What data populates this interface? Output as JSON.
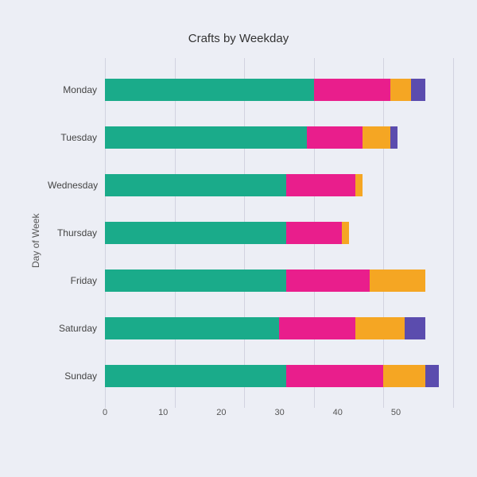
{
  "chart": {
    "title": "Crafts by Weekday",
    "y_axis_label": "Day of Week",
    "x_axis_label": "",
    "x_ticks": [
      0,
      10,
      20,
      30,
      40,
      50
    ],
    "max_value": 50,
    "colors": {
      "teal": "#1aab8a",
      "pink": "#e91e8c",
      "orange": "#f5a623",
      "purple": "#5b4cae"
    },
    "bars": [
      {
        "label": "Monday",
        "segments": [
          {
            "color": "#1aab8a",
            "value": 30
          },
          {
            "color": "#e91e8c",
            "value": 11
          },
          {
            "color": "#f5a623",
            "value": 3
          },
          {
            "color": "#5b4cae",
            "value": 2
          }
        ],
        "total": 46
      },
      {
        "label": "Tuesday",
        "segments": [
          {
            "color": "#1aab8a",
            "value": 29
          },
          {
            "color": "#e91e8c",
            "value": 8
          },
          {
            "color": "#f5a623",
            "value": 4
          },
          {
            "color": "#5b4cae",
            "value": 1
          }
        ],
        "total": 42
      },
      {
        "label": "Wednesday",
        "segments": [
          {
            "color": "#1aab8a",
            "value": 26
          },
          {
            "color": "#e91e8c",
            "value": 10
          },
          {
            "color": "#f5a623",
            "value": 1
          },
          {
            "color": "#5b4cae",
            "value": 0
          }
        ],
        "total": 37
      },
      {
        "label": "Thursday",
        "segments": [
          {
            "color": "#1aab8a",
            "value": 26
          },
          {
            "color": "#e91e8c",
            "value": 8
          },
          {
            "color": "#f5a623",
            "value": 1
          },
          {
            "color": "#5b4cae",
            "value": 0
          }
        ],
        "total": 35
      },
      {
        "label": "Friday",
        "segments": [
          {
            "color": "#1aab8a",
            "value": 26
          },
          {
            "color": "#e91e8c",
            "value": 12
          },
          {
            "color": "#f5a623",
            "value": 8
          },
          {
            "color": "#5b4cae",
            "value": 0
          }
        ],
        "total": 46
      },
      {
        "label": "Saturday",
        "segments": [
          {
            "color": "#1aab8a",
            "value": 25
          },
          {
            "color": "#e91e8c",
            "value": 11
          },
          {
            "color": "#f5a623",
            "value": 7
          },
          {
            "color": "#5b4cae",
            "value": 3
          }
        ],
        "total": 46
      },
      {
        "label": "Sunday",
        "segments": [
          {
            "color": "#1aab8a",
            "value": 26
          },
          {
            "color": "#e91e8c",
            "value": 14
          },
          {
            "color": "#f5a623",
            "value": 6
          },
          {
            "color": "#5b4cae",
            "value": 2
          }
        ],
        "total": 48
      }
    ]
  }
}
